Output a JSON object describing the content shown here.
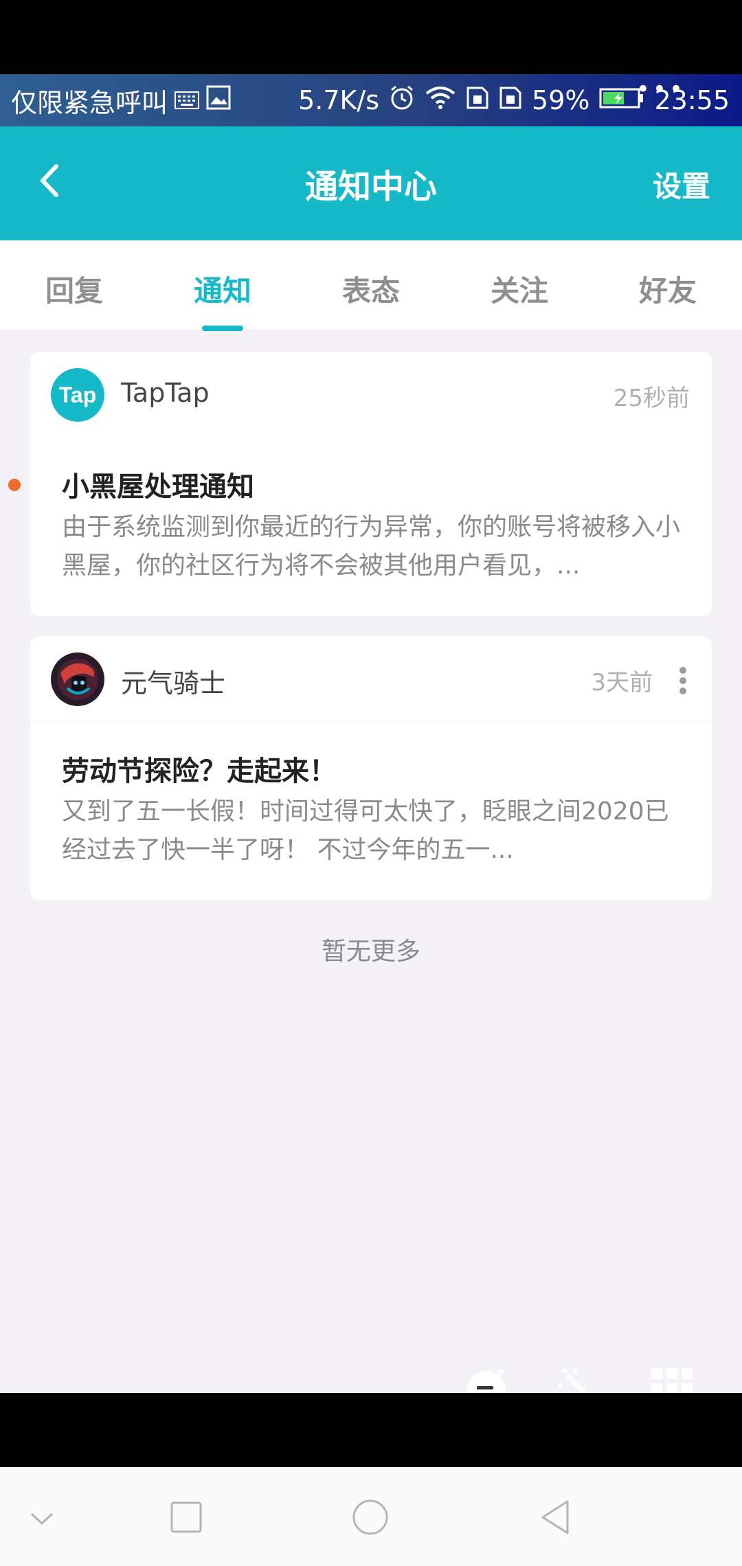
{
  "status_bar": {
    "carrier_text": "仅限紧急呼叫",
    "speed": "5.7K/s",
    "battery": "59%",
    "time": "23:55",
    "more_dots": "•••"
  },
  "appbar": {
    "title": "通知中心",
    "settings_label": "设置"
  },
  "tabs": [
    {
      "label": "回复"
    },
    {
      "label": "通知"
    },
    {
      "label": "表态"
    },
    {
      "label": "关注"
    },
    {
      "label": "好友"
    }
  ],
  "active_tab": "通知",
  "notifications": [
    {
      "sender": "TapTap",
      "avatar_text": "Tap",
      "time": "25秒前",
      "title": "小黑屋处理通知",
      "body": "由于系统监测到你最近的行为异常，你的账号将被移入小黑屋，你的社区行为将不会被其他用户看见，...",
      "unread": true
    },
    {
      "sender": "元气骑士",
      "time": "3天前",
      "title": "劳动节探险？走起来！",
      "body": "又到了五一长假！时间过得可太快了，眨眼之间2020已经过去了快一半了呀！ 不过今年的五一...",
      "unread": false
    }
  ],
  "footer": {
    "no_more": "暂无更多"
  },
  "colors": {
    "accent": "#16b9c8",
    "unread_dot": "#f06a2d",
    "page_bg": "#f5f2f7"
  },
  "icons": [
    "back-arrow-icon",
    "alarm-icon",
    "wifi-icon",
    "sim-icon",
    "battery-icon",
    "more-vertical-icon",
    "chat-bubble-icon",
    "magic-wand-icon",
    "grid-icon",
    "nav-back-icon",
    "nav-home-icon",
    "nav-recents-icon",
    "nav-collapse-icon"
  ]
}
